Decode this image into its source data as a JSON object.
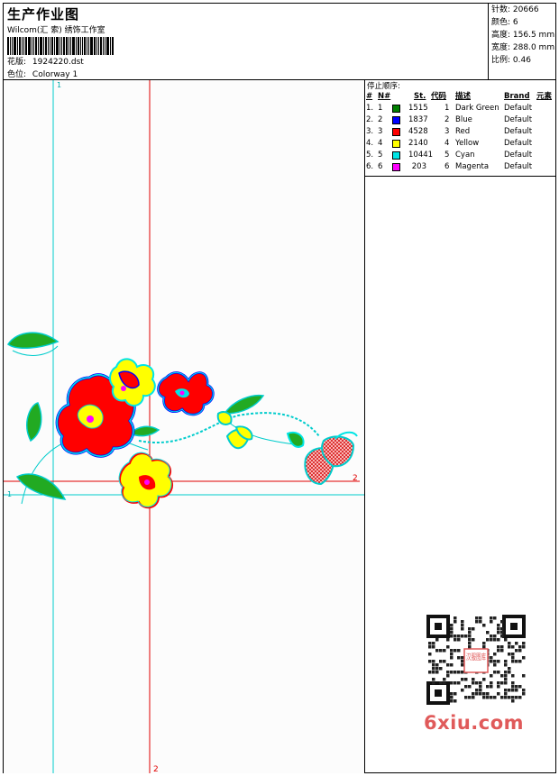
{
  "header": {
    "title": "生产作业图",
    "company": "Wilcom(汇  索) 绣饰工作室",
    "design_label": "花版:",
    "design_value": "1924220.dst",
    "colorway_label": "色位:",
    "colorway_value": "Colorway 1"
  },
  "stats": [
    {
      "label": "针数:",
      "value": "20666"
    },
    {
      "label": "颜色:",
      "value": "6"
    },
    {
      "label": "高度:",
      "value": "156.5 mm"
    },
    {
      "label": "宽度:",
      "value": "288.0 mm"
    },
    {
      "label": "比例:",
      "value": "0.46"
    }
  ],
  "stop_sequence": {
    "title": "停止顺序:",
    "columns": [
      "#",
      "N#",
      "St.",
      "代码",
      "描述",
      "Brand",
      "元素"
    ],
    "rows": [
      {
        "idx": "1.",
        "n": "1",
        "color": "#008000",
        "st": "1515",
        "code": "1",
        "desc": "Dark Green",
        "brand": "Default"
      },
      {
        "idx": "2.",
        "n": "2",
        "color": "#0000ff",
        "st": "1837",
        "code": "2",
        "desc": "Blue",
        "brand": "Default"
      },
      {
        "idx": "3.",
        "n": "3",
        "color": "#ff0000",
        "st": "4528",
        "code": "3",
        "desc": "Red",
        "brand": "Default"
      },
      {
        "idx": "4.",
        "n": "4",
        "color": "#ffff00",
        "st": "2140",
        "code": "4",
        "desc": "Yellow",
        "brand": "Default"
      },
      {
        "idx": "5.",
        "n": "5",
        "color": "#00e5e5",
        "st": "10441",
        "code": "5",
        "desc": "Cyan",
        "brand": "Default"
      },
      {
        "idx": "6.",
        "n": "6",
        "color": "#ff00ff",
        "st": "203",
        "code": "6",
        "desc": "Magenta",
        "brand": "Default"
      }
    ]
  },
  "guides": {
    "cyan_v_label": "1",
    "cyan_h_label": "1",
    "red_h_label": "2",
    "red_v_label": "2"
  },
  "watermark": {
    "stamp_text": "汉服图库",
    "site": "6xiu.com"
  }
}
